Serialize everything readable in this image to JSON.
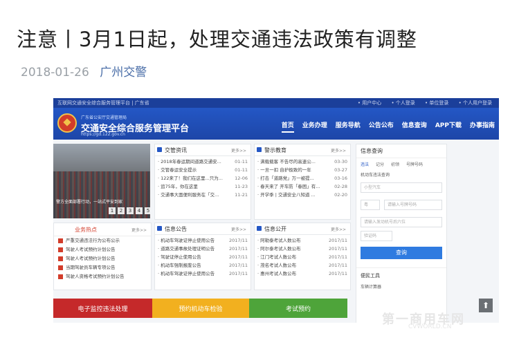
{
  "article": {
    "headline": "注意丨3月1日起，处理交通违法政策有调整",
    "date": "2018-01-26",
    "source": "广州交警"
  },
  "screenshot": {
    "topbar": {
      "left": "互联网交通安全综合服务管理平台 | 广东省",
      "right_items": [
        "• 用户中心",
        "• 个人登录",
        "• 单位登录",
        "• 个人用户登录"
      ]
    },
    "header": {
      "small_text": "广东省公安厅交通管理局",
      "title": "交通安全综合服务管理平台",
      "url": "https://gd.122.gov.cn"
    },
    "nav": [
      "首页",
      "业务办理",
      "服务导航",
      "公告公布",
      "信息查询",
      "APP下载",
      "办事指南"
    ],
    "banner": {
      "caption": "警方全面部署行动，一站式平安到家",
      "pages": [
        "1",
        "2",
        "3",
        "4",
        "5"
      ]
    },
    "traffic_news": {
      "title": "交管资讯",
      "more": "更多>>",
      "items": [
        {
          "text": "· 2018年春运期间道路交通安...",
          "date": "01-11"
        },
        {
          "text": "· 交管春运安全提示",
          "date": "01-11"
        },
        {
          "text": "· 122来了！我们在这里...只为...",
          "date": "12-06"
        },
        {
          "text": "· 追75年，你在这里",
          "date": "11-23"
        },
        {
          "text": "· 交通事大面便利服务在「交...",
          "date": "11-21"
        }
      ]
    },
    "warning_edu": {
      "title": "警示教育",
      "more": "更多>>",
      "items": [
        {
          "text": "· 满载载客 不告尽的高速公...",
          "date": "03-30"
        },
        {
          "text": "· 一旦一扣 自护极致的一年",
          "date": "03-27"
        },
        {
          "text": "· 打击「道路党」万一被提...",
          "date": "03-16"
        },
        {
          "text": "· 春天来了 开车防「春困」有...",
          "date": "02-28"
        },
        {
          "text": "· 开学季 | 交通安全八知道 ...",
          "date": "02-20"
        }
      ]
    },
    "business": {
      "title": "业务热点",
      "more": "更多>>",
      "items": [
        "严重交通违法行为公布公示",
        "驾驶人考试预约计划公告",
        "驾驶人考试预约计划公告",
        "当期驾驶员车辆专项公告",
        "驾驶人资格考试预约计划公告"
      ]
    },
    "info_notice": {
      "title": "信息公告",
      "more": "更多>>",
      "items": [
        {
          "text": "· 机动车驾驶证停止使用公告",
          "date": "2017/11"
        },
        {
          "text": "· 道路交通事故处理证明公告",
          "date": "2017/11"
        },
        {
          "text": "· 驾驶证停止使用公告",
          "date": "2017/11"
        },
        {
          "text": "· 机动车强制报废公告",
          "date": "2017/11"
        },
        {
          "text": "· 机动车驾驶证停止使用公告",
          "date": "2017/11"
        }
      ]
    },
    "info_public": {
      "title": "信息公开",
      "more": "更多>>",
      "items": [
        {
          "text": "· 阿勒泰考试人数公布",
          "date": "2017/11"
        },
        {
          "text": "· 阿尔泰考试人数公布",
          "date": "2017/11"
        },
        {
          "text": "· 江门考试人数公布",
          "date": "2017/11"
        },
        {
          "text": "· 茂名考试人数公布",
          "date": "2017/11"
        },
        {
          "text": "· 惠州考试人数公布",
          "date": "2017/11"
        }
      ]
    },
    "query": {
      "title": "信息查询",
      "tabs": [
        "违法",
        "记分",
        "初领",
        "号牌号码"
      ],
      "label": "机动车违法查询",
      "fields": [
        "小型汽车",
        "粤",
        "请输入号牌号码",
        "请输入发动机号后六位",
        "验证码"
      ],
      "button": "查询",
      "tools_title": "便民工具",
      "tools_item": "车辆计算器"
    },
    "bottom_bars": [
      "电子监控违法处理",
      "预约机动车检验",
      "考试预约"
    ],
    "scroll_top": "⬆"
  },
  "watermark": {
    "main": "第一商用车网",
    "sub": "CVWORLD.CN"
  }
}
